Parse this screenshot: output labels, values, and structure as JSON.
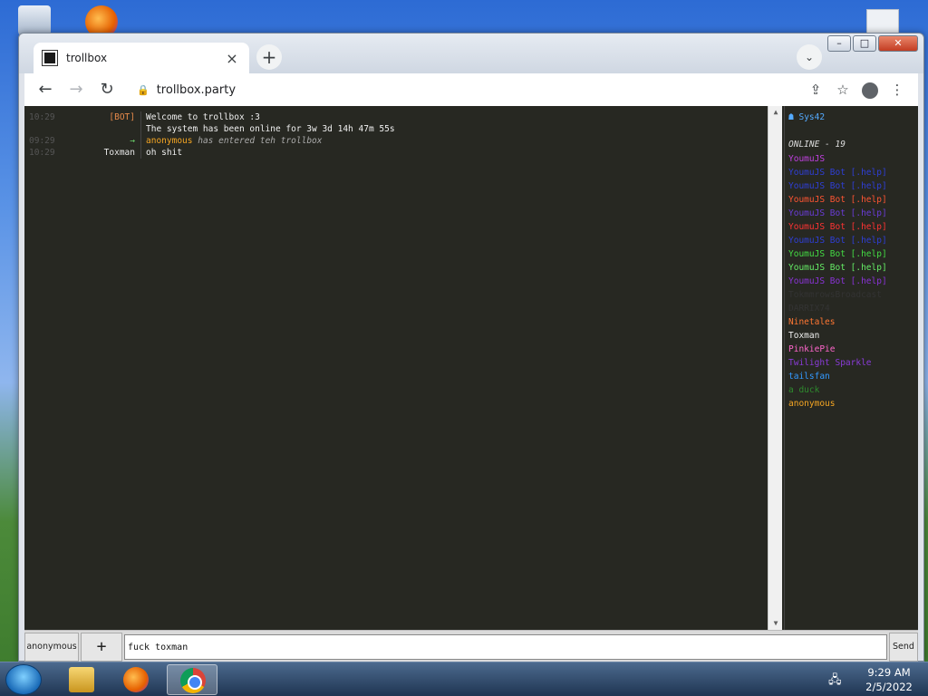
{
  "browser": {
    "tab_title": "trollbox",
    "tab_close": "×",
    "new_tab": "+",
    "tab_search": "⌄",
    "url": "trollbox.party",
    "back": "←",
    "forward": "→",
    "reload": "↻",
    "lock": "🔒",
    "share": "⇪",
    "bookmark": "☆",
    "menu": "⋮",
    "window_controls": {
      "minimize": "–",
      "maximize": "□",
      "close": "✕"
    }
  },
  "chat": {
    "messages": [
      {
        "time": "10:29",
        "nick": "[BOT]",
        "nick_color": "#e88a4a",
        "text": "Welcome to trollbox :3"
      },
      {
        "time": "",
        "nick": "",
        "nick_color": "#e8e8e8",
        "text": "The system has been online for 3w 3d 14h 47m 55s"
      },
      {
        "time": "09:29",
        "nick": "→",
        "nick_color": "#6dd86d",
        "join_nick": "anonymous",
        "join_color": "#f5a623",
        "text": "has entered teh trollbox"
      },
      {
        "time": "10:29",
        "nick": "Toxman",
        "nick_color": "#e8e8e8",
        "text": "oh shit"
      }
    ]
  },
  "userlist": {
    "me": "Sys42",
    "me_icon": "☗",
    "online_label": "ONLINE - 19",
    "users": [
      {
        "name": "YoumuJS",
        "color": "#c040e0"
      },
      {
        "name": "YoumuJS Bot [.help]",
        "color": "#2f3fd8"
      },
      {
        "name": "YoumuJS Bot [.help]",
        "color": "#2f3fd8"
      },
      {
        "name": "YoumuJS Bot [.help]",
        "color": "#ff5533"
      },
      {
        "name": "YoumuJS Bot [.help]",
        "color": "#6a3cd8"
      },
      {
        "name": "YoumuJS Bot [.help]",
        "color": "#ff3333"
      },
      {
        "name": "YoumuJS Bot [.help]",
        "color": "#2f3fd8"
      },
      {
        "name": "YoumuJS Bot [.help]",
        "color": "#44dd44"
      },
      {
        "name": "YoumuJS Bot [.help]",
        "color": "#66ee66"
      },
      {
        "name": "YoumuJS Bot [.help]",
        "color": "#8a33d8"
      },
      {
        "name": "TokmmrowsBroadcast",
        "color": "#333333"
      },
      {
        "name": "DARRIX74",
        "color": "#333333"
      },
      {
        "name": "Ninetales",
        "color": "#ff7733"
      },
      {
        "name": "Toxman",
        "color": "#f0f0f0"
      },
      {
        "name": "PinkiePie",
        "color": "#ff66cc"
      },
      {
        "name": "Twilight Sparkle",
        "color": "#8a3bd8"
      },
      {
        "name": "tailsfan",
        "color": "#3399ff"
      },
      {
        "name": "a duck",
        "color": "#2e8b2e"
      },
      {
        "name": "anonymous",
        "color": "#f5a623"
      }
    ]
  },
  "input": {
    "nick_button": "anonymous",
    "plus_button": "+",
    "value": "fuck toxman",
    "send_button": "Send"
  },
  "taskbar": {
    "time": "9:29 AM",
    "date": "2/5/2022"
  }
}
